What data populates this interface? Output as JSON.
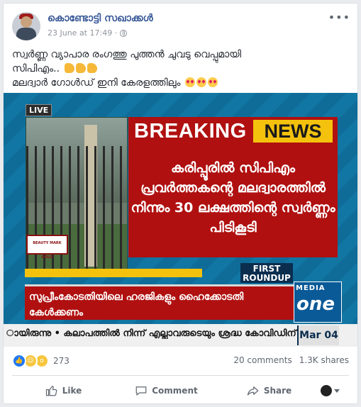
{
  "post": {
    "author": "കൊണ്ടോട്ടി സഖാക്കൾ",
    "timestamp": "23 June at 17:49 ·",
    "privacy_icon": "globe-icon",
    "more_icon": "more-options-icon",
    "text_line1": "സ്വർണ്ണ വ്യാപാര രംഗത്തു പുത്തൻ ചുവടു വെപ്പുമായി",
    "text_line2": "സിപിഎം..",
    "text_line3": "മലദ്വാർ ഗോൾഡ് ഇനി കേരളത്തിലും"
  },
  "media": {
    "live_label": "LIVE",
    "breaking": "BREAKING",
    "news": "NEWS",
    "headline": "കരിപ്പൂരിൽ സിപിഎം പ്രവർത്തകന്റെ മലദ്വാരത്തിൽ നിന്നും 30 ലക്ഷത്തിന്റെ സ്വർണ്ണം പിടികൂടി",
    "first_roundup": "FIRST ROUNDUP",
    "ticker_main": "സുപ്രീംകോടതിയിലെ ഹരജികളും ഹൈക്കോടതി കേൾക്കണം",
    "ticker_bottom": "ായിരുന്നു  •  കലാപത്തിൽ നിന്ന് എല്ലാവരുടെയും ശ്രദ്ധ കോവിഡിന്",
    "channel_top": "MEDIA",
    "channel_main": "one",
    "date": "Mar 04",
    "stamp_text": "BEAUTY MARK GOLD"
  },
  "engagement": {
    "reaction_count": "273",
    "comments": "20 comments",
    "shares": "1.3K shares"
  },
  "actions": {
    "like": "Like",
    "comment": "Comment",
    "share": "Share"
  },
  "colors": {
    "facebook_blue": "#385898",
    "breaking_red": "#b01010",
    "news_yellow": "#f4c20d"
  }
}
